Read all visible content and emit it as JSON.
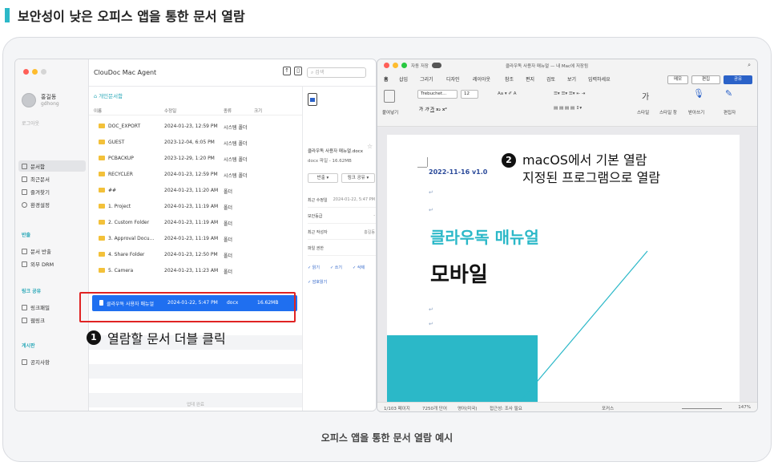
{
  "heading": "보안성이 낮은 오피스 앱을 통한 문서 열람",
  "caption": "오피스 앱을 통한 문서 열람 예시",
  "colors": {
    "accent": "#2bb8c8",
    "selection": "#1f6ff0",
    "highlight": "#e02323",
    "doc_teal": "#2bb8c8"
  },
  "left_window": {
    "app_title": "ClouDoc Mac Agent",
    "search_placeholder": "검색",
    "user": {
      "name": "홍길동",
      "id": "gdhong",
      "logout": "로그아웃"
    },
    "sidebar": {
      "items": [
        {
          "label": "문서함",
          "icon": "folder-icon"
        },
        {
          "label": "최근문서",
          "icon": "document-icon"
        },
        {
          "label": "즐겨찾기",
          "icon": "star-icon"
        },
        {
          "label": "환경설정",
          "icon": "gear-icon"
        }
      ],
      "section_export": "반출",
      "export_items": [
        {
          "label": "문서 반출"
        },
        {
          "label": "외부 DRM"
        }
      ],
      "section_link": "링크 공유",
      "link_items": [
        {
          "label": "링크패밀"
        },
        {
          "label": "웹링크"
        }
      ],
      "section_board": "게시판",
      "board_items": [
        {
          "label": "공지사항"
        }
      ]
    },
    "breadcrumb": "개인문서함",
    "columns": {
      "name": "이름",
      "modified": "수정일",
      "type": "종류",
      "size": "크기"
    },
    "files": [
      {
        "name": "DOC_EXPORT",
        "modified": "2024-01-23, 12:59 PM",
        "type": "시스템 폴더",
        "size": ""
      },
      {
        "name": "GUEST",
        "modified": "2023-12-04, 6:05 PM",
        "type": "시스템 폴더",
        "size": ""
      },
      {
        "name": "PCBACKUP",
        "modified": "2023-12-29, 1:20 PM",
        "type": "시스템 폴더",
        "size": ""
      },
      {
        "name": "RECYCLER",
        "modified": "2024-01-23, 12:59 PM",
        "type": "시스템 폴더",
        "size": ""
      },
      {
        "name": "##",
        "modified": "2024-01-23, 11:20 AM",
        "type": "폴더",
        "size": ""
      },
      {
        "name": "1. Project",
        "modified": "2024-01-23, 11:19 AM",
        "type": "폴더",
        "size": ""
      },
      {
        "name": "2. Custom Folder",
        "modified": "2024-01-23, 11:19 AM",
        "type": "폴더",
        "size": ""
      },
      {
        "name": "3. Approval Docu...",
        "modified": "2024-01-23, 11:19 AM",
        "type": "폴더",
        "size": ""
      },
      {
        "name": "4. Share Folder",
        "modified": "2024-01-23, 12:50 PM",
        "type": "폴더",
        "size": ""
      },
      {
        "name": "5. Camera",
        "modified": "2024-01-23, 11:23 AM",
        "type": "폴더",
        "size": ""
      },
      {
        "name": "클라우독 사용자 매뉴얼",
        "modified": "2024-01-22, 5:47 PM",
        "type": "docx",
        "size": "16.62MB"
      }
    ],
    "selected_file": {
      "name": "클라우독 사용자 매뉴얼",
      "modified": "2024-01-22, 5:47 PM",
      "type": "docx",
      "size": "16.62MB"
    },
    "footer": "업데 완료",
    "preview": {
      "filename": "클라우독 사용자 매뉴얼.docx",
      "meta": "docx 파일 - 16.62MB",
      "btn_export": "반출",
      "btn_link": "링크 공유",
      "rows": [
        {
          "label": "최근 수정일",
          "value": "2024-01-22, 5:47 PM"
        },
        {
          "label": "보안등급",
          "value": "-"
        },
        {
          "label": "최근 작성자",
          "value": "홍길동"
        },
        {
          "label": "파일 권한",
          "value": ""
        }
      ],
      "perms": [
        "읽기",
        "쓰기",
        "삭제",
        "암호읽기"
      ]
    }
  },
  "step1": {
    "number": "1",
    "text": "열람할 문서 더블 클릭"
  },
  "step2": {
    "number": "2",
    "line1": "macOS에서 기본 열람",
    "line2": "지정된 프로그램으로 열람"
  },
  "word": {
    "title": "클라우독 사용자 매뉴얼 — 내 Mac에 저장됨",
    "autosave": "자동 저장",
    "menus": [
      "홈",
      "삽입",
      "그리기",
      "디자인",
      "레이아웃",
      "참조",
      "편지",
      "검토",
      "보기",
      "입력하세요"
    ],
    "btn_memo": "메모",
    "btn_edit": "편집",
    "btn_share": "공유",
    "font": "Trebuchet...",
    "font_size": "12",
    "ribbon_labels": {
      "paste": "붙여넣기",
      "styles": "스타일",
      "style_pane": "스타일 창",
      "dictate": "받아쓰기",
      "editor": "편집자"
    },
    "date_line": "2022-11-16 v1.0",
    "doc_title": "클라우독 매뉴얼",
    "doc_subtitle": "모바일",
    "status": {
      "page": "1/103 페이지",
      "words": "7250개 단어",
      "lang": "영어(미국)",
      "access": "접근성: 조사 필요",
      "focus": "포커스",
      "zoom": "147%"
    }
  }
}
